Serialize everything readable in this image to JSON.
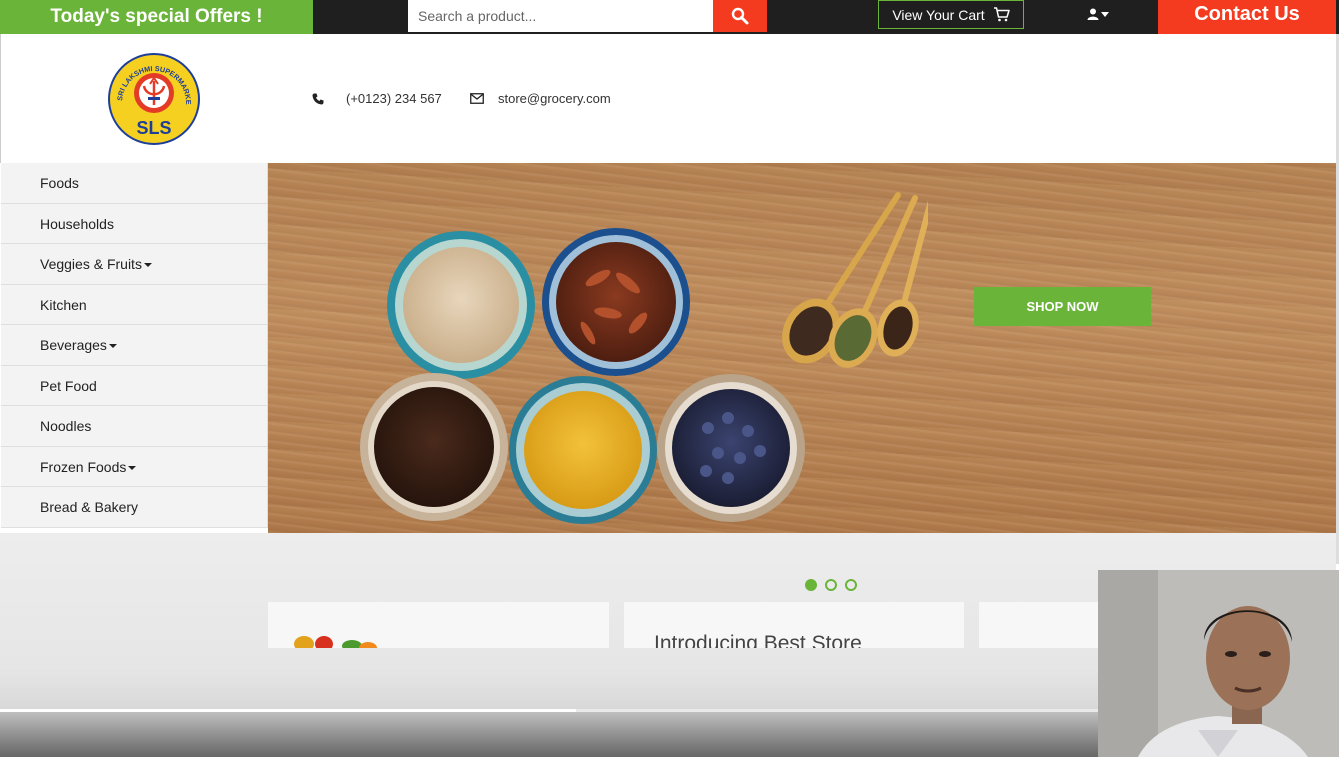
{
  "topbar": {
    "offers_text": "Today's special Offers !",
    "search_placeholder": "Search a product...",
    "cart_label": "View Your Cart",
    "contact_label": "Contact Us"
  },
  "header": {
    "logo_text": "SLS",
    "logo_ring_text": "SRI LAKSHMI SUPERMARKET",
    "phone": "(+0123) 234 567",
    "email": "store@grocery.com"
  },
  "sidebar": {
    "items": [
      {
        "label": "Foods",
        "dropdown": false
      },
      {
        "label": "Households",
        "dropdown": false
      },
      {
        "label": "Veggies & Fruits",
        "dropdown": true
      },
      {
        "label": "Kitchen",
        "dropdown": false
      },
      {
        "label": "Beverages",
        "dropdown": true
      },
      {
        "label": "Pet Food",
        "dropdown": false
      },
      {
        "label": "Noodles",
        "dropdown": false
      },
      {
        "label": "Frozen Foods",
        "dropdown": true
      },
      {
        "label": "Bread & Bakery",
        "dropdown": false
      }
    ]
  },
  "banner": {
    "shop_now_label": "SHOP NOW"
  },
  "carousel": {
    "dot_count": 3,
    "active_index": 0
  },
  "cards": {
    "card2_text": "Introducing Best Store"
  },
  "video": {
    "progress_fraction": 0.43
  },
  "colors": {
    "green": "#6bb43a",
    "red": "#f53b1f",
    "topbar": "#1f1f1f"
  }
}
